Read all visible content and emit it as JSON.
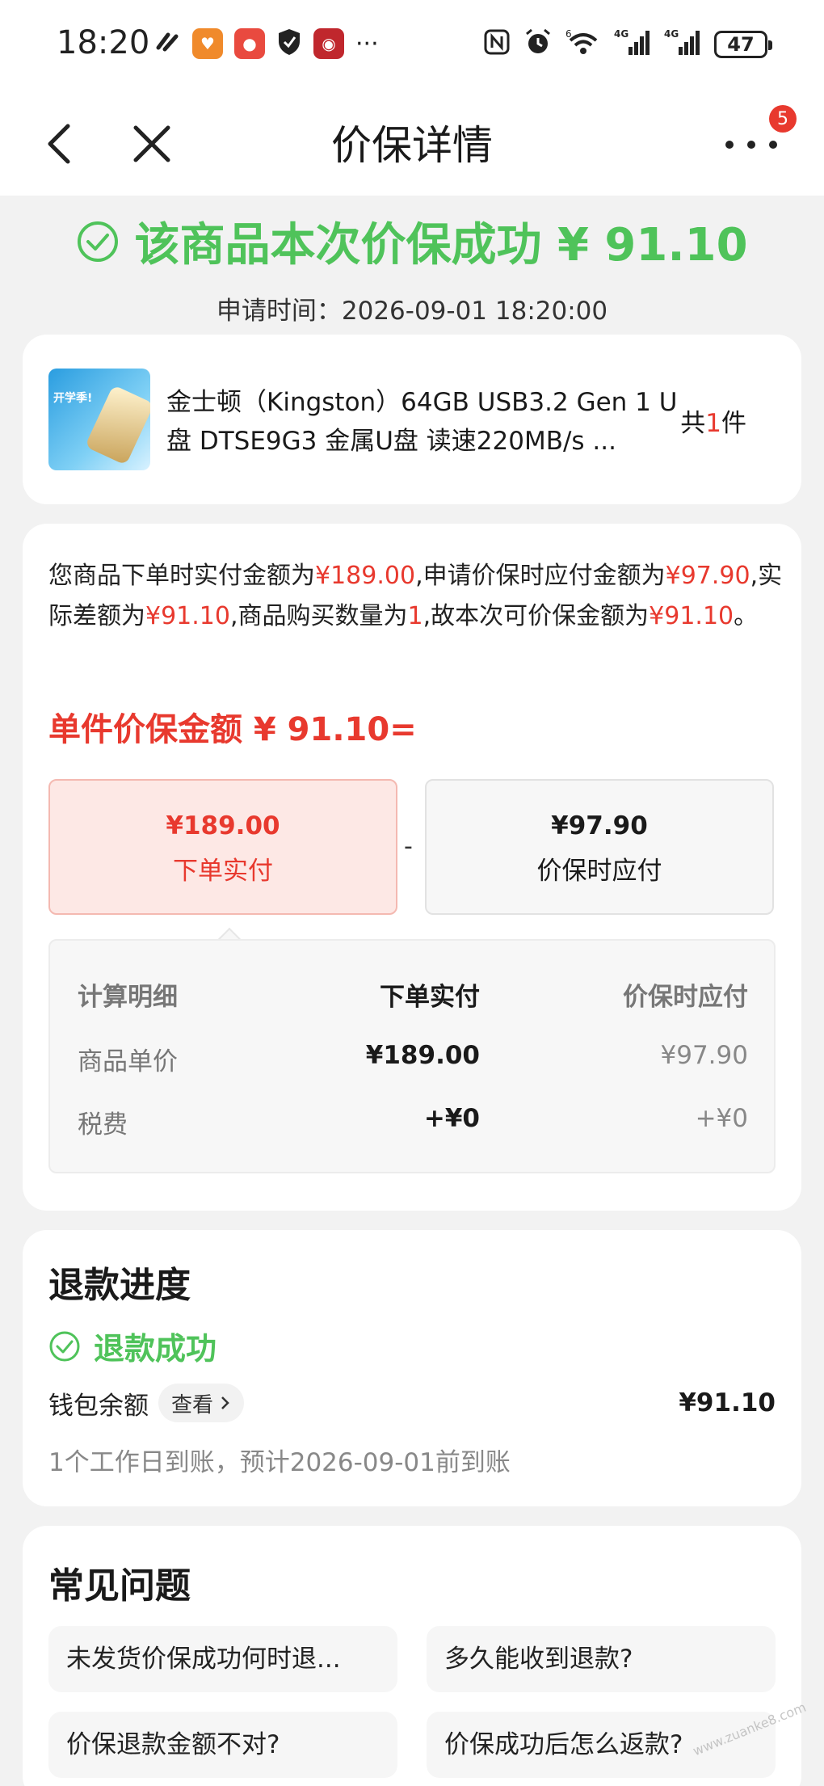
{
  "status_bar": {
    "time": "18:20",
    "signal_label_1": "4G",
    "signal_label_2": "4G",
    "wifi_label": "6",
    "battery": "47",
    "more_dots": "···"
  },
  "nav": {
    "title": "价保详情",
    "more_badge": "5"
  },
  "result": {
    "title": "该商品本次价保成功 ¥ 91.10",
    "apply_time_label": "申请时间：",
    "apply_time": "2026-09-01 18:20:00"
  },
  "product": {
    "name": "金士顿（Kingston）64GB USB3.2 Gen 1 U盘 DTSE9G3 金属U盘 读速220MB/s ...",
    "count_prefix": "共",
    "count": "1",
    "count_suffix": "件",
    "thumb_text": "开学季!"
  },
  "detail": {
    "desc": [
      "您商品下单时实付金额为",
      "¥189.00",
      ",申请价保时应付金额为",
      "¥97.90",
      ",实际差额为",
      "¥91.10",
      ",商品购买数量为",
      "1",
      ",故本次可价保金额为",
      "¥91.10",
      "。"
    ],
    "unit_amount": "单件价保金额 ¥ 91.10=",
    "paid_value": "¥189.00",
    "paid_label": "下单实付",
    "minus": "-",
    "guarantee_value": "¥97.90",
    "guarantee_label": "价保时应付",
    "table": {
      "headers": [
        "计算明细",
        "下单实付",
        "价保时应付"
      ],
      "rows": [
        [
          "商品单价",
          "¥189.00",
          "¥97.90"
        ],
        [
          "税费",
          "+¥0",
          "+¥0"
        ]
      ]
    }
  },
  "refund": {
    "title": "退款进度",
    "status": "退款成功",
    "wallet_label": "钱包余额",
    "view_label": "查看",
    "amount": "¥91.10",
    "arrival": "1个工作日到账，预计2026-09-01前到账"
  },
  "faq": {
    "title": "常见问题",
    "items": [
      "未发货价保成功何时退...",
      "多久能收到退款?",
      "价保退款金额不对?",
      "价保成功后怎么返款?"
    ]
  },
  "watermark": "www.zuanke8.com",
  "colors": {
    "success": "#4fc35a",
    "accent_red": "#e8392e"
  }
}
